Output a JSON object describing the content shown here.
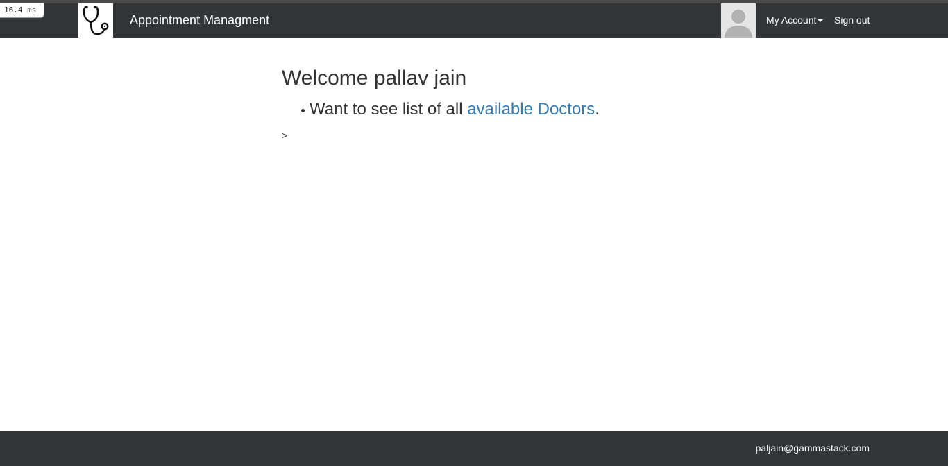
{
  "devtools": {
    "timing_value": "16.4",
    "timing_unit": "ms"
  },
  "navbar": {
    "logo_icon": "stethoscope-icon",
    "brand": "Appointment Managment",
    "avatar_icon": "user-avatar-icon",
    "my_account": "My Account",
    "sign_out": "Sign out"
  },
  "main": {
    "welcome": "Welcome pallav jain",
    "list_prefix": "Want to see list of all ",
    "doctors_link": "available Doctors",
    "list_suffix": ".",
    "stray_char": ">"
  },
  "footer": {
    "email": "paljain@gammastack.com"
  },
  "colors": {
    "navbar_bg": "#333638",
    "link": "#337ab7",
    "text": "#333333"
  }
}
